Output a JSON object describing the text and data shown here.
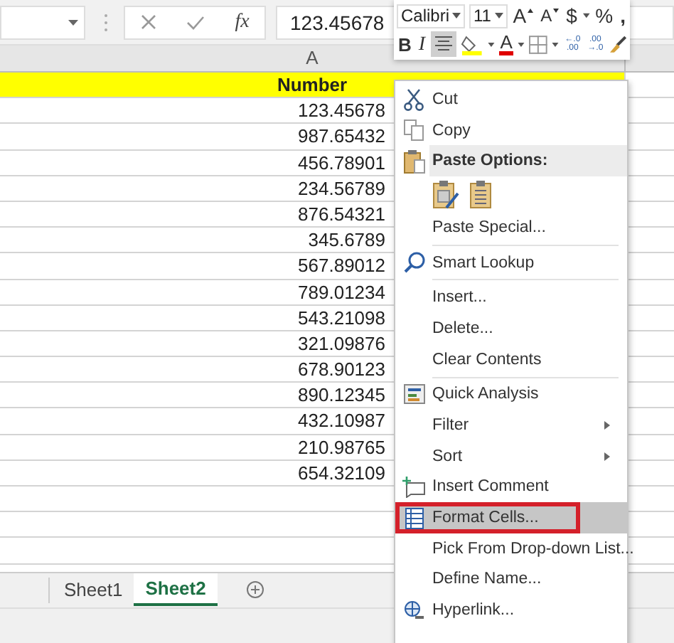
{
  "formula_bar": {
    "fx": "fx",
    "value": "123.45678"
  },
  "column_header": "A",
  "sheet": {
    "header": "Number",
    "rows": [
      "123.45678",
      "987.65432",
      "456.78901",
      "234.56789",
      "876.54321",
      "345.6789",
      "567.89012",
      "789.01234",
      "543.21098",
      "321.09876",
      "678.90123",
      "890.12345",
      "432.10987",
      "210.98765",
      "654.32109"
    ]
  },
  "sheet_tabs": [
    {
      "label": "Sheet1",
      "selected": false
    },
    {
      "label": "Sheet2",
      "selected": true
    }
  ],
  "mini_toolbar": {
    "font": "Calibri",
    "size": "11",
    "grow": "A",
    "shrink": "A",
    "currency": "$",
    "percent": "%",
    "comma": ",",
    "bold": "B",
    "italic": "I",
    "center_selected": true,
    "font_color": "A",
    "increase_decimal": [
      "←.0",
      ".00"
    ],
    "decrease_decimal": [
      ".00",
      "→.0"
    ]
  },
  "context_menu": [
    {
      "kind": "item",
      "label": "Cut",
      "selected": false,
      "boxed": false,
      "submenu": false
    },
    {
      "kind": "item",
      "label": "Copy",
      "selected": false,
      "boxed": false,
      "submenu": false
    },
    {
      "kind": "header",
      "label": "Paste Options:"
    },
    {
      "kind": "paste_icons"
    },
    {
      "kind": "item",
      "label": "Paste Special...",
      "selected": false,
      "boxed": false,
      "submenu": false
    },
    {
      "kind": "separator"
    },
    {
      "kind": "item",
      "label": "Smart Lookup",
      "selected": false,
      "boxed": false,
      "submenu": false
    },
    {
      "kind": "separator"
    },
    {
      "kind": "item",
      "label": "Insert...",
      "selected": false,
      "boxed": false,
      "submenu": false
    },
    {
      "kind": "item",
      "label": "Delete...",
      "selected": false,
      "boxed": false,
      "submenu": false
    },
    {
      "kind": "item",
      "label": "Clear Contents",
      "selected": false,
      "boxed": false,
      "submenu": false
    },
    {
      "kind": "separator"
    },
    {
      "kind": "item",
      "label": "Quick Analysis",
      "selected": false,
      "boxed": false,
      "submenu": false
    },
    {
      "kind": "item",
      "label": "Filter",
      "selected": false,
      "boxed": false,
      "submenu": true
    },
    {
      "kind": "item",
      "label": "Sort",
      "selected": false,
      "boxed": false,
      "submenu": true
    },
    {
      "kind": "item",
      "label": "Insert Comment",
      "selected": false,
      "boxed": false,
      "submenu": false
    },
    {
      "kind": "item",
      "label": "Format Cells...",
      "selected": true,
      "boxed": true,
      "submenu": false
    },
    {
      "kind": "item",
      "label": "Pick From Drop-down List...",
      "selected": false,
      "boxed": false,
      "submenu": false
    },
    {
      "kind": "item",
      "label": "Define Name...",
      "selected": false,
      "boxed": false,
      "submenu": false
    },
    {
      "kind": "item",
      "label": "Hyperlink...",
      "selected": false,
      "boxed": false,
      "submenu": false
    }
  ]
}
